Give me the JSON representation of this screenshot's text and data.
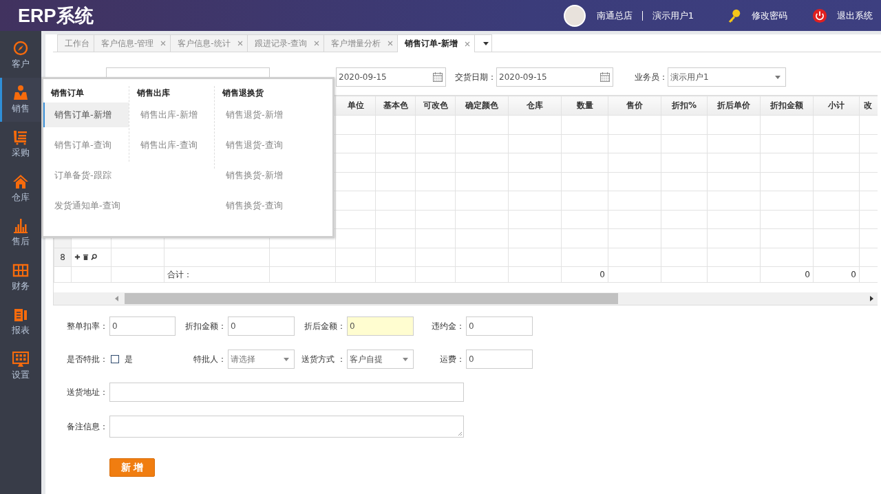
{
  "header": {
    "title": "ERP系统",
    "store": "南通总店",
    "user": "演示用户1",
    "actions": [
      {
        "kind": "key",
        "label": "修改密码"
      },
      {
        "kind": "power",
        "label": "退出系统"
      }
    ]
  },
  "sidebar": {
    "items": [
      {
        "kind": "compass",
        "label": "客户",
        "selected": false
      },
      {
        "kind": "seller",
        "label": "销售",
        "selected": true
      },
      {
        "kind": "cart",
        "label": "采购",
        "selected": false
      },
      {
        "kind": "house",
        "label": "仓库",
        "selected": false
      },
      {
        "kind": "bars",
        "label": "售后",
        "selected": false
      },
      {
        "kind": "abacus",
        "label": "财务",
        "selected": false
      },
      {
        "kind": "report",
        "label": "报表",
        "selected": false
      },
      {
        "kind": "monitor",
        "label": "设置",
        "selected": false
      }
    ]
  },
  "tabs": [
    {
      "label": "工作台",
      "closable": false,
      "selected": false
    },
    {
      "label": "客户信息-管理",
      "closable": true,
      "selected": false
    },
    {
      "label": "客户信息-统计",
      "closable": true,
      "selected": false
    },
    {
      "label": "跟进记录-查询",
      "closable": true,
      "selected": false
    },
    {
      "label": "客户增量分析",
      "closable": true,
      "selected": false
    },
    {
      "label": "销售订单-新增",
      "closable": true,
      "selected": true
    }
  ],
  "top_form": {
    "order_date": "2020-09-15",
    "delivery_date_label": "交货日期：",
    "delivery_date": "2020-09-15",
    "salesperson_label": "业务员：",
    "salesperson": "演示用户1"
  },
  "table": {
    "columns": [
      {},
      {},
      {},
      {
        "total": "合计："
      },
      {},
      {
        "label": "单位"
      },
      {
        "label": "基本色"
      },
      {
        "label": "可改色"
      },
      {
        "label": "确定颜色"
      },
      {
        "label": "仓库"
      },
      {
        "label": "数量",
        "total": "0"
      },
      {
        "label": "售价"
      },
      {
        "label": "折扣%"
      },
      {
        "label": "折后单价"
      },
      {
        "label": "折扣金额",
        "total": "0"
      },
      {
        "label": "小计",
        "total": "0"
      },
      {
        "label": "改"
      }
    ],
    "rows": [
      {},
      {},
      {},
      {},
      {},
      {},
      {},
      {
        "number": "8",
        "tools": true
      }
    ]
  },
  "menu": {
    "groups": [
      {
        "title": "销售订单",
        "items": [
          {
            "label": "销售订单-新增",
            "selected": true
          },
          {
            "label": "销售订单-查询",
            "selected": false
          },
          {
            "label": "订单备货-跟踪",
            "selected": false
          },
          {
            "label": "发货通知单-查询",
            "selected": false
          }
        ]
      },
      {
        "title": "销售出库",
        "items": [
          {
            "label": "销售出库-新增",
            "selected": false
          },
          {
            "label": "销售出库-查询",
            "selected": false
          }
        ]
      },
      {
        "title": "销售退换货",
        "items": [
          {
            "label": "销售退货-新增",
            "selected": false
          },
          {
            "label": "销售退货-查询",
            "selected": false
          },
          {
            "label": "销售换货-新增",
            "selected": false
          },
          {
            "label": "销售换货-查询",
            "selected": false
          }
        ]
      }
    ]
  },
  "bottom_form": {
    "rows": [
      [
        {
          "kind": "text",
          "label": "整单扣率：",
          "value": "0",
          "highlighted": false
        },
        {
          "kind": "text",
          "label": "折扣金额：",
          "value": "0",
          "highlighted": false
        },
        {
          "kind": "text",
          "label": "折后金额：",
          "value": "0",
          "highlighted": true
        },
        {
          "kind": "text",
          "label": "违约金：",
          "value": "0",
          "highlighted": false
        }
      ],
      [
        {
          "kind": "checkbox",
          "label": "是否特批：",
          "option": "是",
          "checked": false
        },
        {
          "kind": "select",
          "label": "特批人：",
          "placeholder": "请选择"
        },
        {
          "kind": "select",
          "label": "送货方式 ：",
          "value": "客户自提"
        },
        {
          "kind": "text",
          "label": "运费：",
          "value": "0",
          "highlighted": false
        }
      ],
      [
        {
          "kind": "wide",
          "label": "送货地址："
        }
      ],
      [
        {
          "kind": "textarea",
          "label": "备注信息："
        }
      ]
    ],
    "submit": "新 增"
  }
}
